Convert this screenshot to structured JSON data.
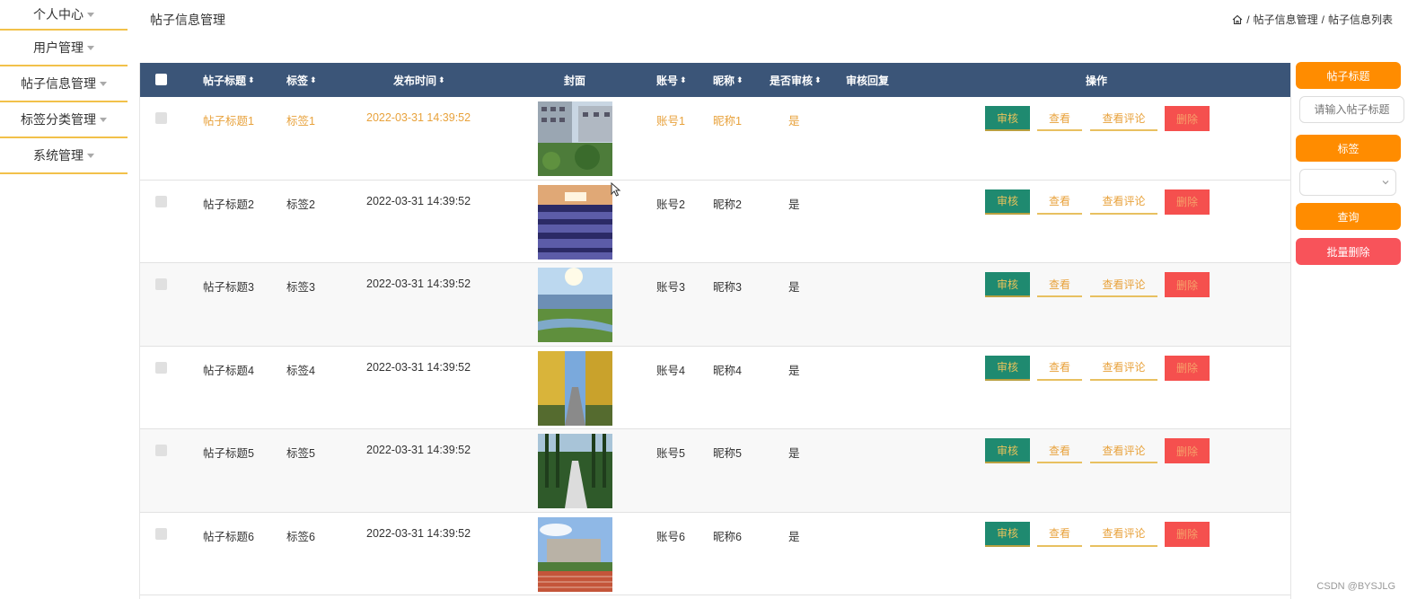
{
  "sidebar": {
    "items": [
      {
        "label": "个人中心"
      },
      {
        "label": "用户管理"
      },
      {
        "label": "帖子信息管理"
      },
      {
        "label": "标签分类管理"
      },
      {
        "label": "系统管理"
      }
    ]
  },
  "header": {
    "title": "帖子信息管理",
    "breadcrumb": [
      "帖子信息管理",
      "帖子信息列表"
    ],
    "separator": "/"
  },
  "table": {
    "columns": {
      "title": "帖子标题",
      "tag": "标签",
      "time": "发布时间",
      "cover": "封面",
      "account": "账号",
      "nickname": "昵称",
      "reviewed": "是否审核",
      "reply": "审核回复",
      "actions": "操作"
    },
    "rows": [
      {
        "title": "帖子标题1",
        "tag": "标签1",
        "time": "2022-03-31 14:39:52",
        "account": "账号1",
        "nickname": "昵称1",
        "reviewed": "是",
        "reply": ""
      },
      {
        "title": "帖子标题2",
        "tag": "标签2",
        "time": "2022-03-31 14:39:52",
        "account": "账号2",
        "nickname": "昵称2",
        "reviewed": "是",
        "reply": ""
      },
      {
        "title": "帖子标题3",
        "tag": "标签3",
        "time": "2022-03-31 14:39:52",
        "account": "账号3",
        "nickname": "昵称3",
        "reviewed": "是",
        "reply": ""
      },
      {
        "title": "帖子标题4",
        "tag": "标签4",
        "time": "2022-03-31 14:39:52",
        "account": "账号4",
        "nickname": "昵称4",
        "reviewed": "是",
        "reply": ""
      },
      {
        "title": "帖子标题5",
        "tag": "标签5",
        "time": "2022-03-31 14:39:52",
        "account": "账号5",
        "nickname": "昵称5",
        "reviewed": "是",
        "reply": ""
      },
      {
        "title": "帖子标题6",
        "tag": "标签6",
        "time": "2022-03-31 14:39:52",
        "account": "账号6",
        "nickname": "昵称6",
        "reviewed": "是",
        "reply": ""
      }
    ],
    "actions": {
      "audit": "审核",
      "view": "查看",
      "comments": "查看评论",
      "delete": "删除"
    }
  },
  "search": {
    "title_label": "帖子标题",
    "title_placeholder": "请输入帖子标题",
    "tag_label": "标签",
    "query_button": "查询",
    "batch_delete_button": "批量删除"
  },
  "watermark": "CSDN @BYSJLG",
  "colors": {
    "header_bg": "#3b5578",
    "accent_orange": "#ff8c00",
    "danger_red": "#f8535a",
    "audit_green": "#1f8a70",
    "highlight_text": "#e8a23c",
    "sidebar_divider": "#f2c14a"
  }
}
